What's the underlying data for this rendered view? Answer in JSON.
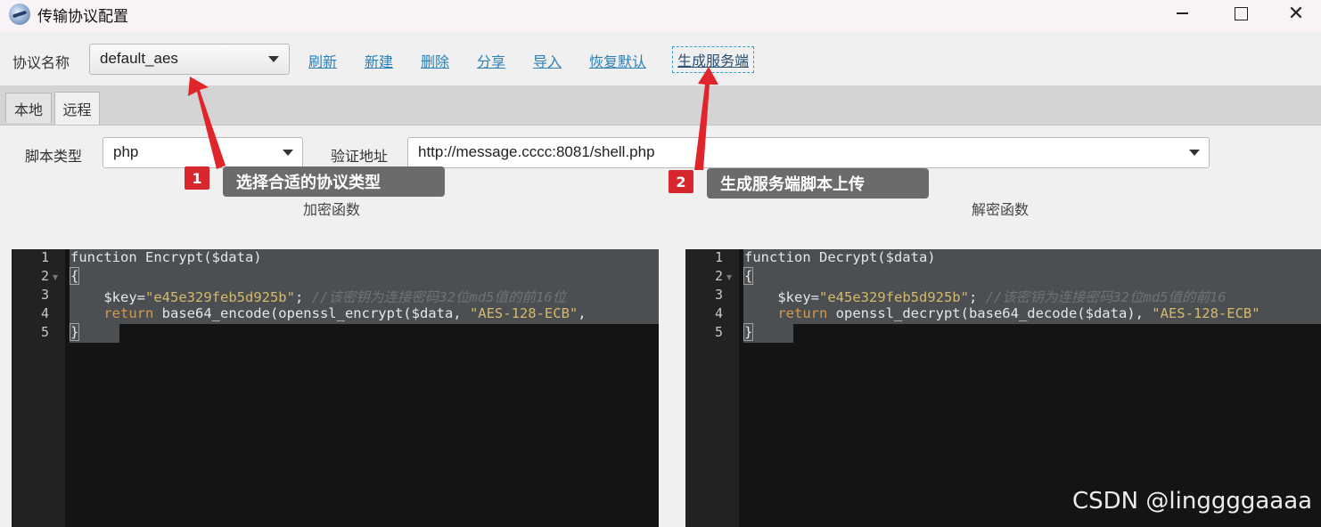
{
  "window": {
    "title": "传输协议配置"
  },
  "toolbar": {
    "protocol_label": "协议名称",
    "protocol_value": "default_aes",
    "links": [
      "刷新",
      "新建",
      "删除",
      "分享",
      "导入",
      "恢复默认",
      "生成服务端"
    ]
  },
  "tabs": [
    {
      "label": "本地",
      "active": false
    },
    {
      "label": "远程",
      "active": true
    }
  ],
  "remote": {
    "script_type_label": "脚本类型",
    "script_type_value": "php",
    "verify_url_label": "验证地址",
    "verify_url_value": "http://message.cccc:8081/shell.php"
  },
  "callouts": [
    {
      "num": "1",
      "text": "选择合适的协议类型"
    },
    {
      "num": "2",
      "text": "生成服务端脚本上传"
    }
  ],
  "encrypt": {
    "title": "加密函数",
    "line_numbers": [
      "1",
      "2",
      "3",
      "4",
      "5"
    ],
    "lines": [
      "function Encrypt($data)",
      "{",
      "    $key=\"e45e329feb5d925b\"; //该密钥为连接密码32位md5值的前16位",
      "    return base64_encode(openssl_encrypt($data, \"AES-128-ECB\",",
      "}"
    ]
  },
  "decrypt": {
    "title": "解密函数",
    "line_numbers": [
      "1",
      "2",
      "3",
      "4",
      "5"
    ],
    "lines": [
      "function Decrypt($data)",
      "{",
      "    $key=\"e45e329feb5d925b\"; //该密钥为连接密码32位md5值的前16",
      "    return openssl_decrypt(base64_decode($data), \"AES-128-ECB\"",
      "}"
    ]
  },
  "watermark": "CSDN @linggggaaaa",
  "colors": {
    "link": "#2a7fb8",
    "callout_badge": "#d8262f",
    "callout_bg": "#6b6b6b",
    "arrow": "#e0262c",
    "editor_bg": "#141414"
  }
}
